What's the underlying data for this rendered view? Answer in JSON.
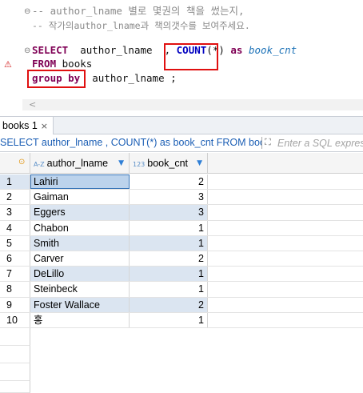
{
  "editor": {
    "comment_line1": "-- author_lname 별로 몇권의 책을 썼는지,",
    "comment_line2": "-- 작가의author_lname과 책의갯수를 보여주세요.",
    "select_kw": "SELECT",
    "select_col": "author_lname",
    "select_comma": ",",
    "count_fn": "COUNT",
    "count_arg": "(*)",
    "as_kw": "as",
    "alias": "book_cnt",
    "from_kw": "FROM",
    "from_table": "books",
    "group_kw": "group by",
    "group_col": "author_lname",
    "semicolon": ";",
    "scroll_left_arrow": "<"
  },
  "results_tab": {
    "label": "books 1",
    "close_glyph": "×"
  },
  "query_bar": {
    "text": "SELECT author_lname , COUNT(*) as book_cnt FROM books group by author_lname",
    "filter_placeholder": "Enter a SQL expression to filter results"
  },
  "grid": {
    "columns": [
      {
        "type_badge": "A-Z",
        "label": "author_lname"
      },
      {
        "type_badge": "123",
        "label": "book_cnt"
      }
    ],
    "rows": [
      {
        "num": "1",
        "author_lname": "Lahiri",
        "book_cnt": "2"
      },
      {
        "num": "2",
        "author_lname": "Gaiman",
        "book_cnt": "3"
      },
      {
        "num": "3",
        "author_lname": "Eggers",
        "book_cnt": "3"
      },
      {
        "num": "4",
        "author_lname": "Chabon",
        "book_cnt": "1"
      },
      {
        "num": "5",
        "author_lname": "Smith",
        "book_cnt": "1"
      },
      {
        "num": "6",
        "author_lname": "Carver",
        "book_cnt": "2"
      },
      {
        "num": "7",
        "author_lname": "DeLillo",
        "book_cnt": "1"
      },
      {
        "num": "8",
        "author_lname": "Steinbeck",
        "book_cnt": "1"
      },
      {
        "num": "9",
        "author_lname": "Foster Wallace",
        "book_cnt": "2"
      },
      {
        "num": "10",
        "author_lname": "홍",
        "book_cnt": "1"
      }
    ]
  },
  "colors": {
    "keyword": "#7f0055",
    "function": "#0000c0",
    "highlight_box": "#e01010",
    "query_text": "#1c5fb5",
    "alt_row": "#dbe5f1"
  }
}
